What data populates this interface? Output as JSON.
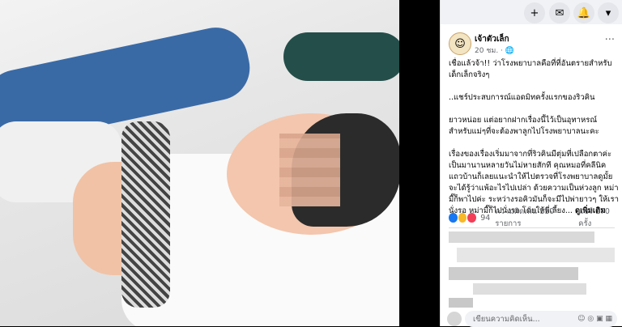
{
  "topbar": {
    "icons": [
      "plus-icon",
      "messenger-icon",
      "notifications-icon",
      "dropdown-icon"
    ]
  },
  "post": {
    "page_name": "เจ้าตัวเล็ก",
    "time": "20 ชม. ·",
    "paragraphs": [
      "เชื่อแล้วจ้า!! ว่าโรงพยาบาลคือที่ที่อันตรายสำหรับเด็กเล็กจริงๆ",
      "..แชร์ประสบการณ์แอดมิทครั้งแรกของริวคิน",
      "ยาวหน่อย แต่อยากฝากเรื่องนี้ไว้เป็นอุทาหรณ์สำหรับแม่ๆที่จะต้องพาลูกไปโรงพยาบาลนะคะ",
      "เรื่องของเรื่องเริ่มมาจากที่ริวคินมีตุ่มที่เปลือกตาค่ะ เป็นมานานหลายวันไม่หายสักที คุณหมอที่คลีนิคแถวบ้านก็เลยแนะนำให้ไปตรวจที่โรงพยาบาลดูมั้ยจะได้รู้ว่าแพ้อะไรไปเปล่า ด้วยความเป็นห่วงลูก หม่ามี๊ก็พาไปค่ะ ระหว่างรอคิวมันก็จะมีไปพ่ายาวๆ ให้เรานั่งรอ หม่ามี๊ก็ไปนั่งรอ โดยให้พี่เลี้ยง..."
    ],
    "see_more": "ดูเพิ่มเติม"
  },
  "stats": {
    "reaction_count": "94",
    "comments": "ความคิดเห็น 110 รายการ",
    "shares": "แชร์ 170 ครั้ง"
  },
  "comment_box": {
    "placeholder": "เขียนความคิดเห็น..."
  },
  "colors": {
    "like": "#1877f2",
    "haha": "#f7b928",
    "love": "#f33e58"
  }
}
